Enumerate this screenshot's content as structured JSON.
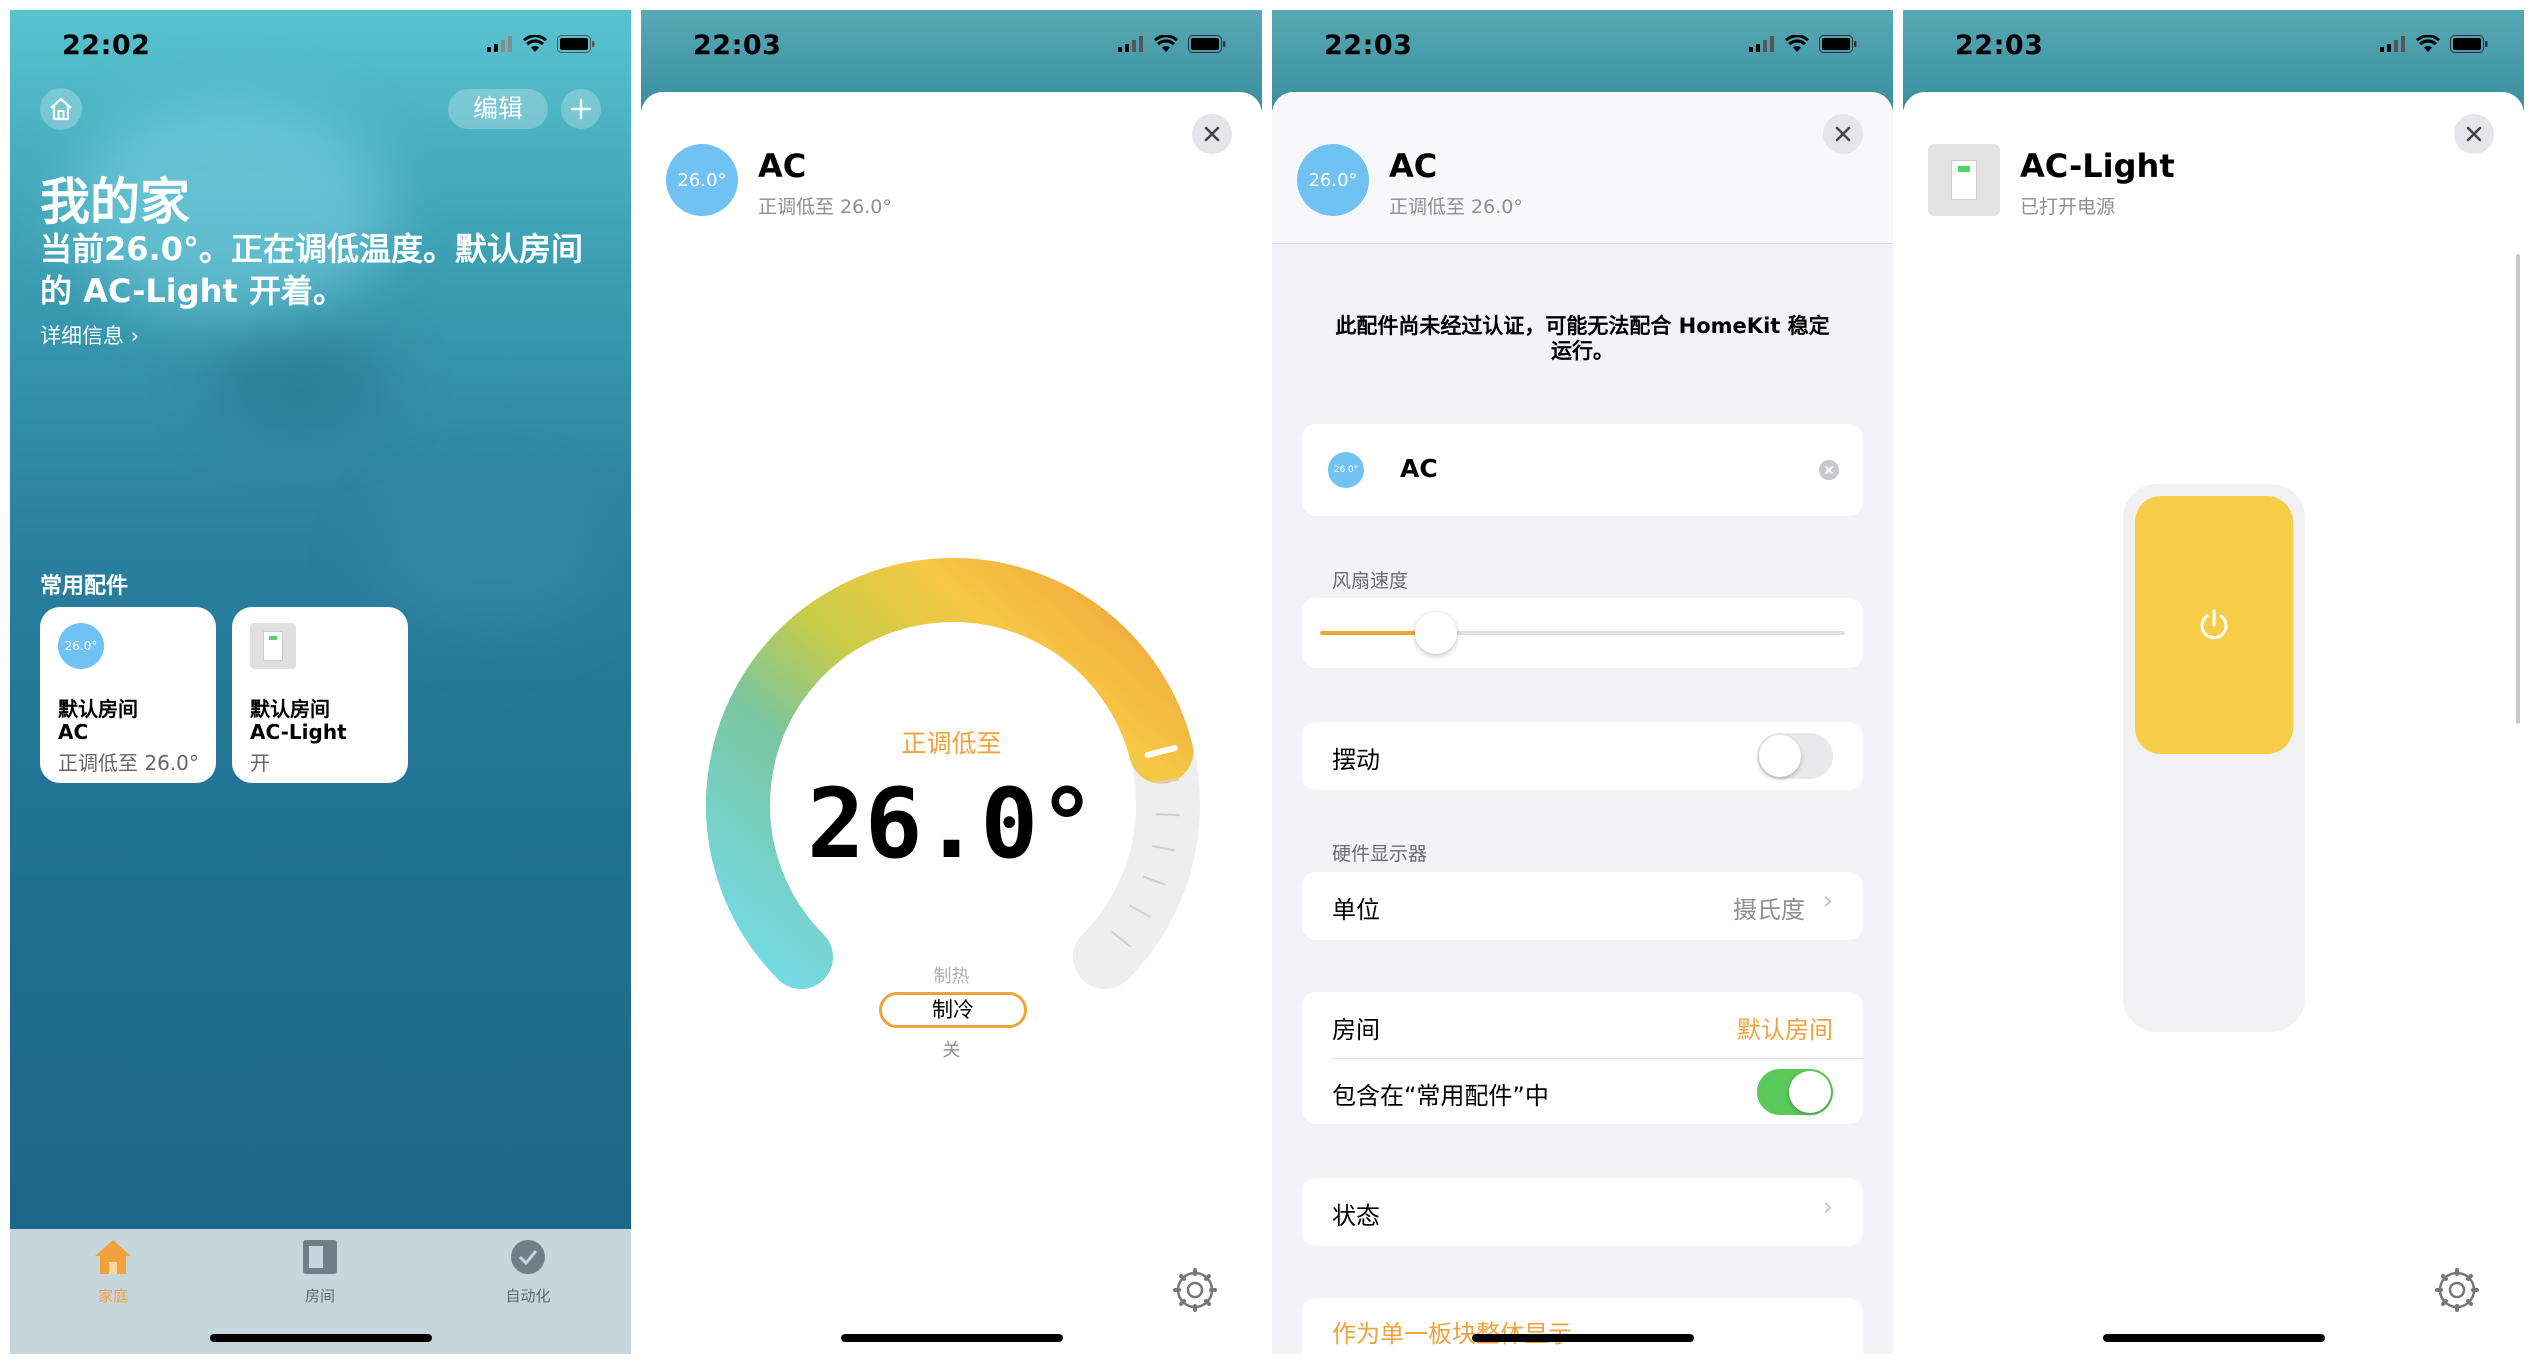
{
  "screen1": {
    "time": "22:02",
    "edit_label": "编辑",
    "title": "我的家",
    "summary": "当前26.0°。正在调低温度。默认房间的 AC-Light 开着。",
    "details_link": "详细信息 ›",
    "favorites_label": "常用配件",
    "tiles": [
      {
        "icon_text": "26.0°",
        "room": "默认房间",
        "name": "AC",
        "state": "正调低至 26.0°"
      },
      {
        "room": "默认房间",
        "name": "AC-Light",
        "state": "开"
      }
    ],
    "tabs": [
      {
        "label": "家庭",
        "icon": "house-icon",
        "active": true
      },
      {
        "label": "房间",
        "icon": "rooms-icon",
        "active": false
      },
      {
        "label": "自动化",
        "icon": "automation-icon",
        "active": false
      }
    ]
  },
  "screen2": {
    "time": "22:03",
    "name": "AC",
    "status": "正调低至 26.0°",
    "icon_text": "26.0°",
    "mode_status": "正调低至",
    "target_temp": "26.0°",
    "target_level": 0.78,
    "modes": {
      "above": "制热",
      "selected": "制冷",
      "below": "关"
    }
  },
  "screen3": {
    "time": "22:03",
    "name": "AC",
    "status": "正调低至 26.0°",
    "icon_text": "26.0°",
    "warning": "此配件尚未经过认证，可能无法配合 HomeKit 稳定运行。",
    "name_field": {
      "icon_text": "26.0°",
      "value": "AC"
    },
    "fan_speed_label": "风扇速度",
    "fan_speed_level": 0.22,
    "swing_label": "摆动",
    "swing_on": false,
    "hardware_display_label": "硬件显示器",
    "unit_label": "单位",
    "unit_value": "摄氏度",
    "room_label": "房间",
    "room_value": "默认房间",
    "include_label": "包含在“常用配件”中",
    "include_on": true,
    "status_label": "状态",
    "tile_display_label": "作为单一板块整体显示",
    "accent_color": "#f0a23c",
    "toggle_on_color": "#5ac85a"
  },
  "screen4": {
    "time": "22:03",
    "name": "AC-Light",
    "status": "已打开电源",
    "light_color": "#f7cc46",
    "brightness_level": 1.0
  }
}
